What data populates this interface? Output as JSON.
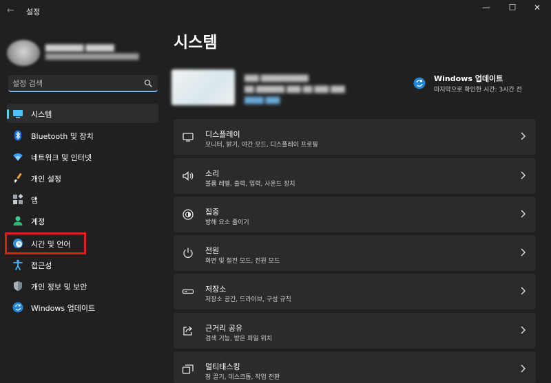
{
  "window": {
    "app_title": "설정",
    "back_glyph": "←",
    "minimize_glyph": "—",
    "maximize_glyph": "☐",
    "close_glyph": "✕"
  },
  "search": {
    "placeholder": "설정 검색",
    "icon": "search-icon"
  },
  "sidebar": {
    "items": [
      {
        "label": "시스템",
        "icon": "monitor-icon",
        "active": true
      },
      {
        "label": "Bluetooth 및 장치",
        "icon": "bluetooth-icon"
      },
      {
        "label": "네트워크 및 인터넷",
        "icon": "wifi-icon"
      },
      {
        "label": "개인 설정",
        "icon": "brush-icon"
      },
      {
        "label": "앱",
        "icon": "apps-icon"
      },
      {
        "label": "계정",
        "icon": "person-icon"
      },
      {
        "label": "시간 및 언어",
        "icon": "globe-clock-icon",
        "highlighted": true
      },
      {
        "label": "접근성",
        "icon": "accessibility-icon"
      },
      {
        "label": "개인 정보 및 보안",
        "icon": "shield-icon"
      },
      {
        "label": "Windows 업데이트",
        "icon": "update-icon"
      }
    ]
  },
  "main": {
    "title": "시스템",
    "windows_update": {
      "title": "Windows 업데이트",
      "subtitle": "마지막으로 확인한 시간: 3시간 전"
    },
    "cards": [
      {
        "title": "디스플레이",
        "subtitle": "모니터, 밝기, 야간 모드, 디스플레이 프로필",
        "icon": "display-icon"
      },
      {
        "title": "소리",
        "subtitle": "볼륨 레벨, 출력, 입력, 사운드 장치",
        "icon": "speaker-icon"
      },
      {
        "title": "집중",
        "subtitle": "방해 요소 줄이기",
        "icon": "focus-icon"
      },
      {
        "title": "전원",
        "subtitle": "화면 및 절전 모드, 전원 모드",
        "icon": "power-icon"
      },
      {
        "title": "저장소",
        "subtitle": "저장소 공간, 드라이브, 구성 규칙",
        "icon": "storage-icon"
      },
      {
        "title": "근거리 공유",
        "subtitle": "검색 기능, 받은 파일 위치",
        "icon": "share-icon"
      },
      {
        "title": "멀티태스킹",
        "subtitle": "창 끌기, 데스크톱, 작업 전환",
        "icon": "multitask-icon"
      }
    ]
  },
  "colors": {
    "accent": "#60cdff",
    "highlight_box": "#e11d1d",
    "background": "#202020",
    "card": "#2b2b2b"
  }
}
